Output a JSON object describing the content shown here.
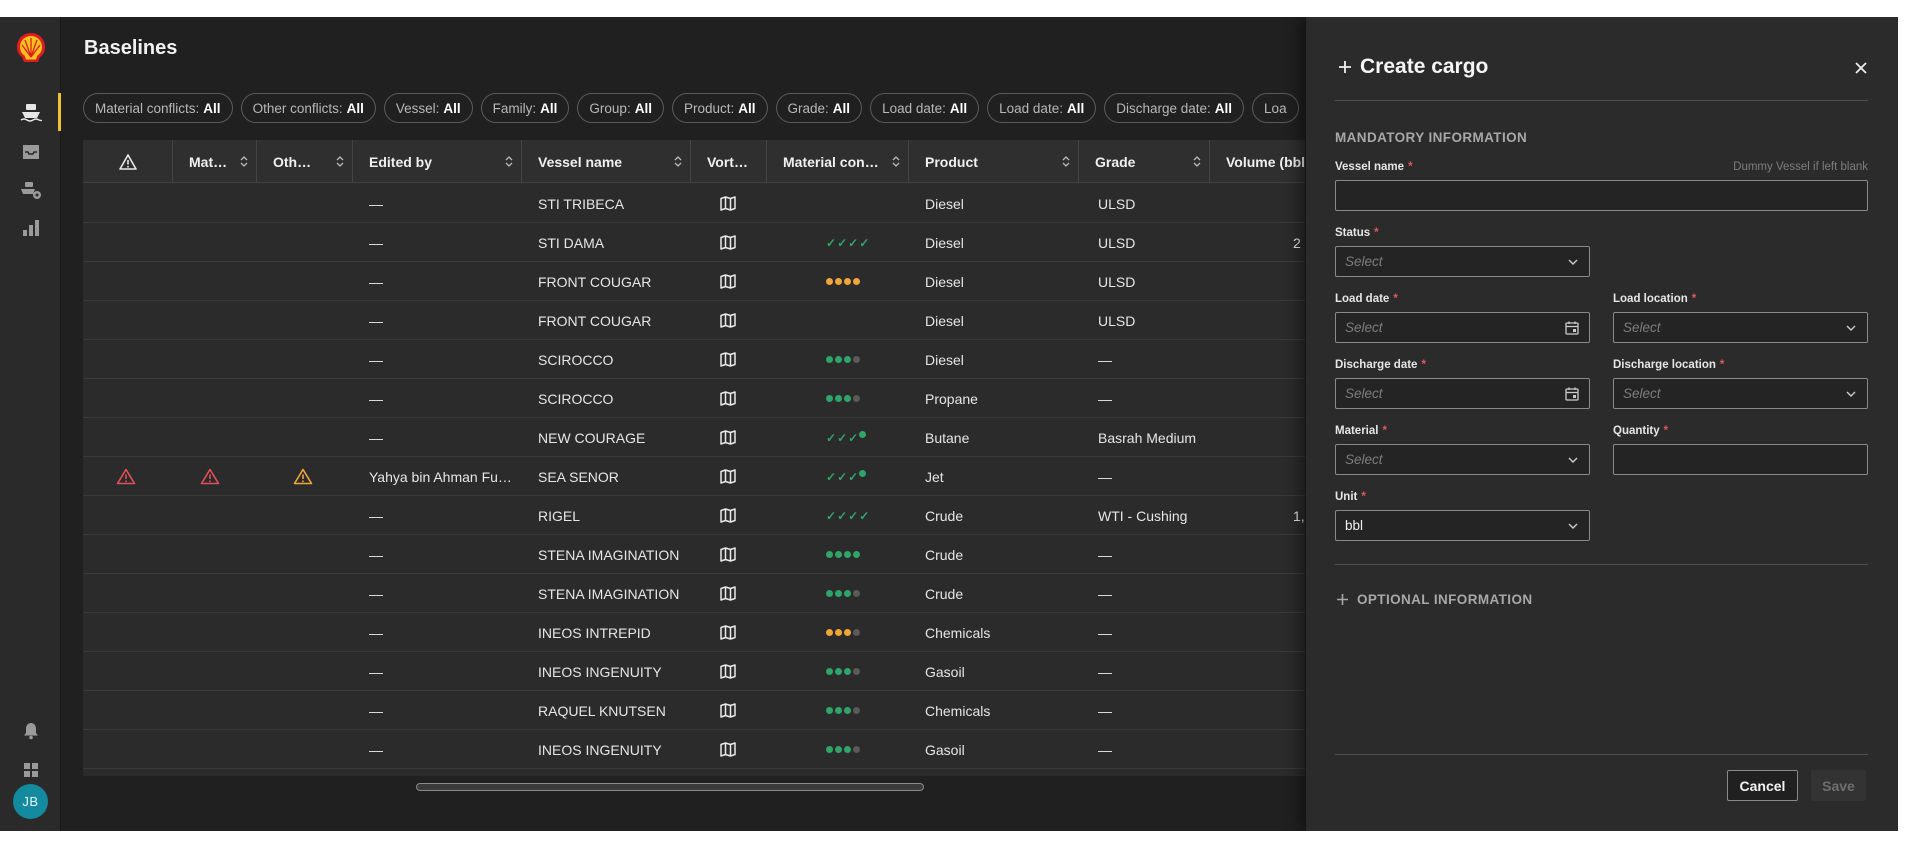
{
  "app": {
    "title": "Baselines",
    "brand_color": "#f2c12e",
    "avatar_initials": "JB"
  },
  "sidebar": {
    "items": [
      {
        "icon": "ship-icon",
        "active": true
      },
      {
        "icon": "inbox-icon",
        "active": false
      },
      {
        "icon": "ship-settings-icon",
        "active": false
      },
      {
        "icon": "bar-chart-icon",
        "active": false
      }
    ],
    "bottom_items": [
      {
        "icon": "bell-icon"
      },
      {
        "icon": "grid-icon"
      }
    ]
  },
  "filters": [
    {
      "label": "Material conflicts:",
      "value": "All"
    },
    {
      "label": "Other conflicts:",
      "value": "All"
    },
    {
      "label": "Vessel:",
      "value": "All"
    },
    {
      "label": "Family:",
      "value": "All"
    },
    {
      "label": "Group:",
      "value": "All"
    },
    {
      "label": "Product:",
      "value": "All"
    },
    {
      "label": "Grade:",
      "value": "All"
    },
    {
      "label": "Load date:",
      "value": "All"
    },
    {
      "label": "Load date:",
      "value": "All"
    },
    {
      "label": "Discharge date:",
      "value": "All"
    },
    {
      "label": "Loa",
      "value": ""
    }
  ],
  "table": {
    "columns": [
      "Mat…",
      "Oth…",
      "Edited by",
      "Vessel name",
      "Vort…",
      "Material con…",
      "Product",
      "Grade",
      "Volume (bbl"
    ],
    "rows": [
      {
        "warn1": false,
        "warn2": false,
        "warn3": false,
        "edited_by": "—",
        "vessel": "STI TRIBECA",
        "status": "none",
        "product": "Diesel",
        "grade": "ULSD",
        "volume": ""
      },
      {
        "warn1": false,
        "warn2": false,
        "warn3": false,
        "edited_by": "—",
        "vessel": "STI DAMA",
        "status": "checks4",
        "product": "Diesel",
        "grade": "ULSD",
        "volume": "2"
      },
      {
        "warn1": false,
        "warn2": false,
        "warn3": false,
        "edited_by": "—",
        "vessel": "FRONT COUGAR",
        "status": "orange4",
        "product": "Diesel",
        "grade": "ULSD",
        "volume": ""
      },
      {
        "warn1": false,
        "warn2": false,
        "warn3": false,
        "edited_by": "—",
        "vessel": "FRONT COUGAR",
        "status": "none",
        "product": "Diesel",
        "grade": "ULSD",
        "volume": ""
      },
      {
        "warn1": false,
        "warn2": false,
        "warn3": false,
        "edited_by": "—",
        "vessel": "SCIROCCO",
        "status": "green3",
        "product": "Diesel",
        "grade": "—",
        "volume": ""
      },
      {
        "warn1": false,
        "warn2": false,
        "warn3": false,
        "edited_by": "—",
        "vessel": "SCIROCCO",
        "status": "green3",
        "product": "Propane",
        "grade": "—",
        "volume": ""
      },
      {
        "warn1": false,
        "warn2": false,
        "warn3": false,
        "edited_by": "—",
        "vessel": "NEW COURAGE",
        "status": "checks3dot",
        "product": "Butane",
        "grade": "Basrah Medium",
        "volume": ""
      },
      {
        "warn1": true,
        "warn2": true,
        "warn3": true,
        "edited_by": "Yahya bin Ahman Fu…",
        "vessel": "SEA SENOR",
        "status": "checks3dot",
        "product": "Jet",
        "grade": "—",
        "volume": ""
      },
      {
        "warn1": false,
        "warn2": false,
        "warn3": false,
        "edited_by": "—",
        "vessel": "RIGEL",
        "status": "checks4",
        "product": "Crude",
        "grade": "WTI - Cushing",
        "volume": "1,"
      },
      {
        "warn1": false,
        "warn2": false,
        "warn3": false,
        "edited_by": "—",
        "vessel": "STENA IMAGINATION",
        "status": "green4",
        "product": "Crude",
        "grade": "—",
        "volume": ""
      },
      {
        "warn1": false,
        "warn2": false,
        "warn3": false,
        "edited_by": "—",
        "vessel": "STENA IMAGINATION",
        "status": "green3",
        "product": "Crude",
        "grade": "—",
        "volume": ""
      },
      {
        "warn1": false,
        "warn2": false,
        "warn3": false,
        "edited_by": "—",
        "vessel": "INEOS INTREPID",
        "status": "orange3",
        "product": "Chemicals",
        "grade": "—",
        "volume": ""
      },
      {
        "warn1": false,
        "warn2": false,
        "warn3": false,
        "edited_by": "—",
        "vessel": "INEOS INGENUITY",
        "status": "green3",
        "product": "Gasoil",
        "grade": "—",
        "volume": ""
      },
      {
        "warn1": false,
        "warn2": false,
        "warn3": false,
        "edited_by": "—",
        "vessel": "RAQUEL KNUTSEN",
        "status": "green3",
        "product": "Chemicals",
        "grade": "—",
        "volume": ""
      },
      {
        "warn1": false,
        "warn2": false,
        "warn3": false,
        "edited_by": "—",
        "vessel": "INEOS INGENUITY",
        "status": "green3",
        "product": "Gasoil",
        "grade": "—",
        "volume": ""
      }
    ]
  },
  "panel": {
    "title": "Create cargo",
    "mandatory_title": "MANDATORY INFORMATION",
    "optional_title": "OPTIONAL INFORMATION",
    "vessel_name": {
      "label": "Vessel name",
      "hint": "Dummy Vessel if left blank",
      "value": ""
    },
    "status": {
      "label": "Status",
      "placeholder": "Select"
    },
    "load_date": {
      "label": "Load date",
      "placeholder": "Select"
    },
    "load_location": {
      "label": "Load location",
      "placeholder": "Select"
    },
    "discharge_date": {
      "label": "Discharge date",
      "placeholder": "Select"
    },
    "discharge_location": {
      "label": "Discharge location",
      "placeholder": "Select"
    },
    "material": {
      "label": "Material",
      "placeholder": "Select"
    },
    "quantity": {
      "label": "Quantity",
      "value": ""
    },
    "unit": {
      "label": "Unit",
      "value": "bbl"
    },
    "cancel_label": "Cancel",
    "save_label": "Save",
    "required_marker": "*"
  },
  "colors": {
    "green": "#2fa56a",
    "orange": "#f0a63a",
    "red": "#e2505a",
    "grey_dot": "#5a5a5a"
  }
}
